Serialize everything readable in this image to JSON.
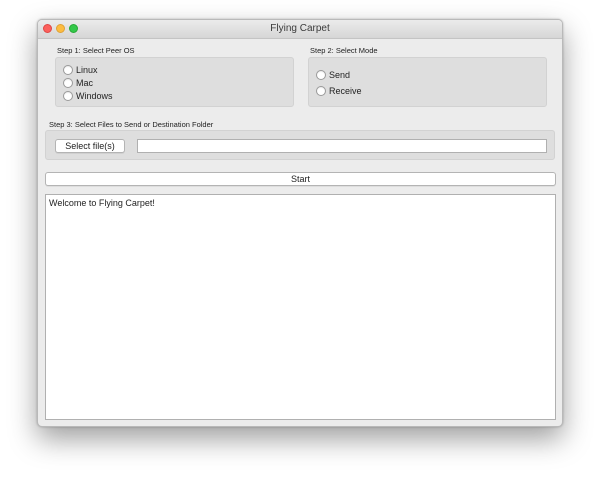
{
  "window": {
    "title": "Flying Carpet"
  },
  "step1": {
    "label": "Step 1: Select Peer OS",
    "options": [
      {
        "label": "Linux",
        "selected": false
      },
      {
        "label": "Mac",
        "selected": false
      },
      {
        "label": "Windows",
        "selected": false
      }
    ]
  },
  "step2": {
    "label": "Step 2: Select Mode",
    "options": [
      {
        "label": "Send",
        "selected": false
      },
      {
        "label": "Receive",
        "selected": false
      }
    ]
  },
  "step3": {
    "label": "Step 3: Select Files to Send or Destination Folder",
    "select_button": "Select file(s)",
    "path_value": ""
  },
  "start_button": "Start",
  "log": {
    "text": "Welcome to Flying Carpet!"
  }
}
